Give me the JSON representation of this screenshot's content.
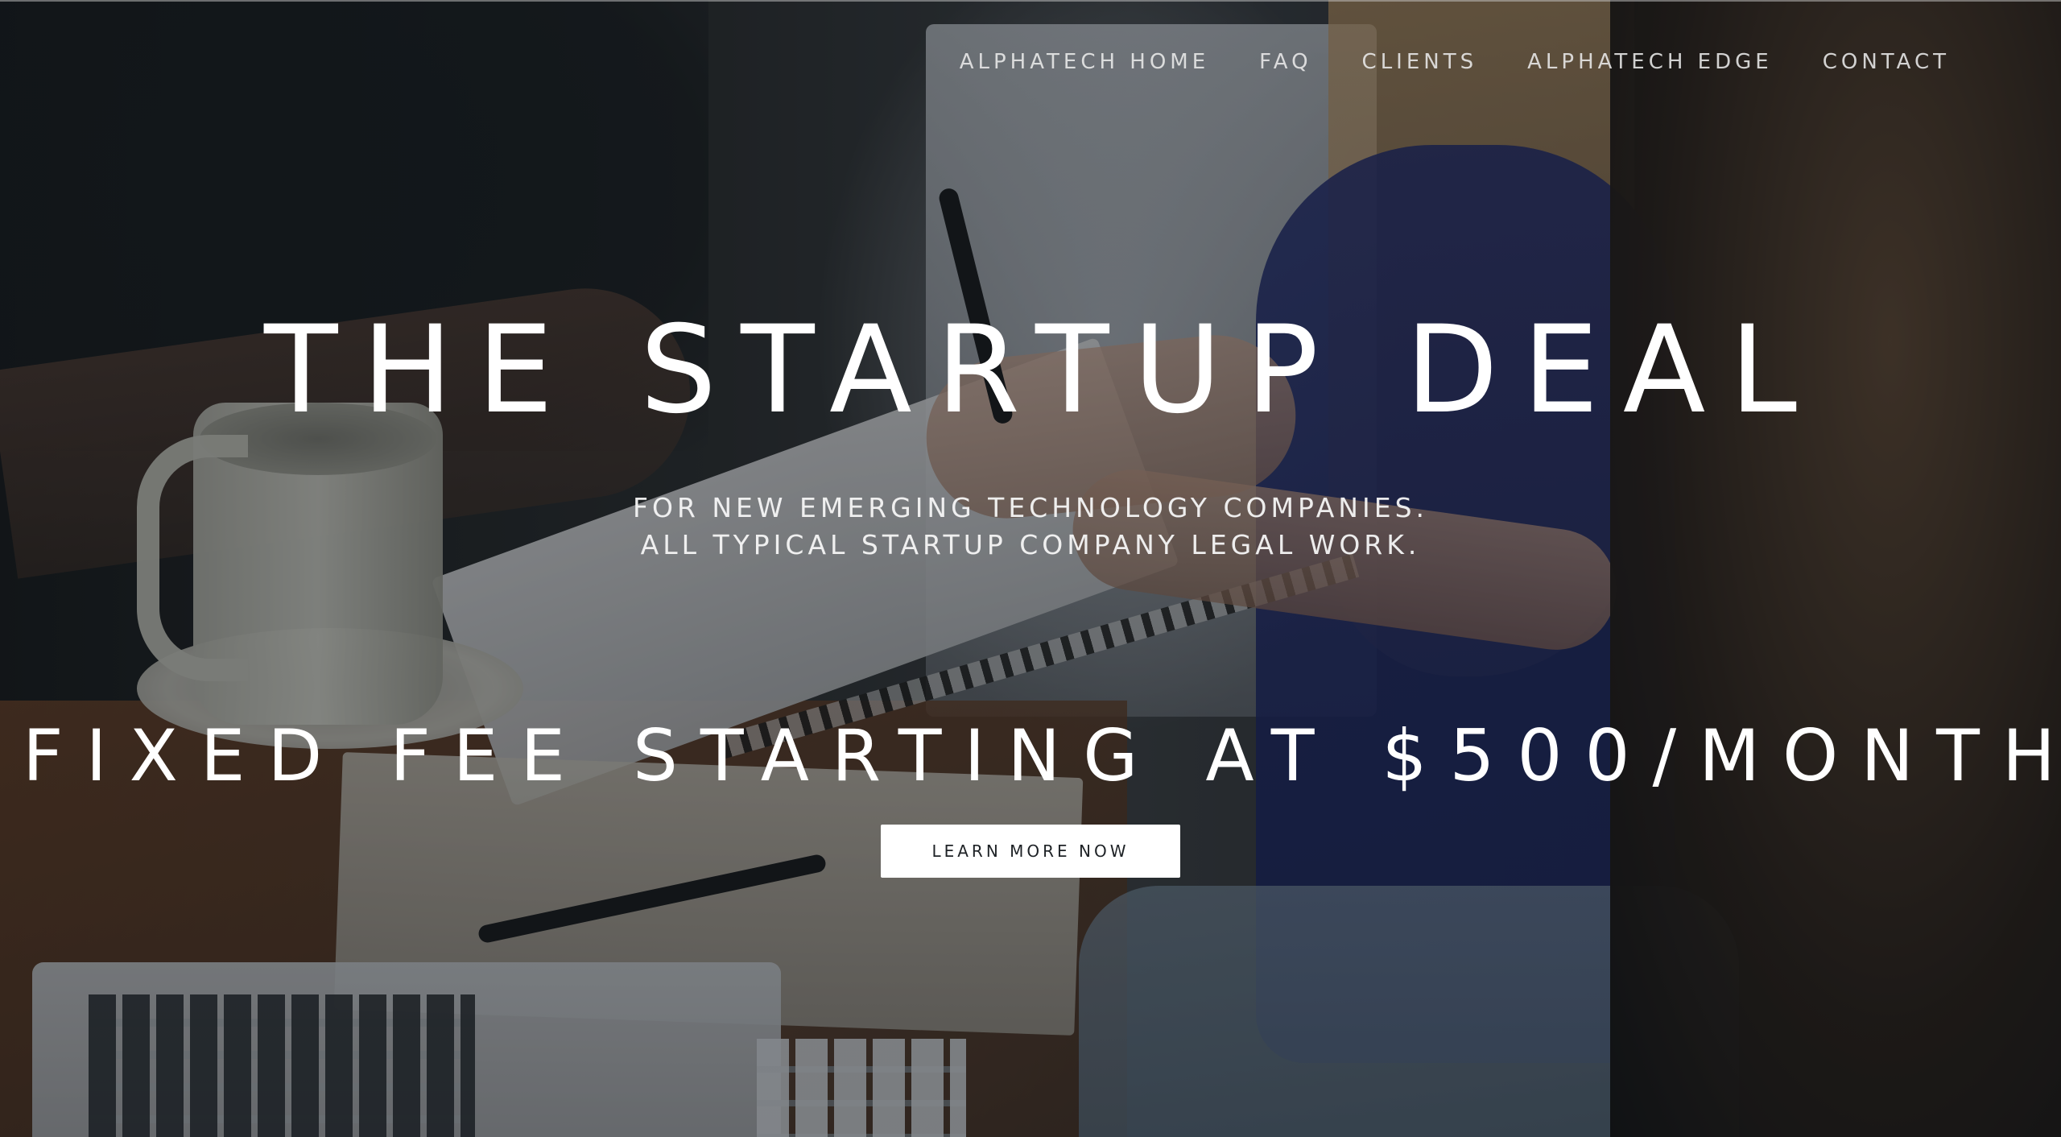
{
  "nav": {
    "items": [
      {
        "label": "ALPHATECH HOME"
      },
      {
        "label": "FAQ"
      },
      {
        "label": "CLIENTS"
      },
      {
        "label": "ALPHATECH EDGE"
      },
      {
        "label": "CONTACT"
      }
    ]
  },
  "hero": {
    "title": "THE STARTUP DEAL",
    "subtitle_lines": [
      "FOR NEW EMERGING TECHNOLOGY COMPANIES.",
      "ALL TYPICAL STARTUP COMPANY LEGAL WORK."
    ],
    "price": "FIXED FEE STARTING AT $500/MONTH",
    "cta_label": "LEARN MORE NOW"
  },
  "colors": {
    "text": "#ffffff",
    "button_bg": "#ffffff",
    "button_text": "#1e2226"
  }
}
